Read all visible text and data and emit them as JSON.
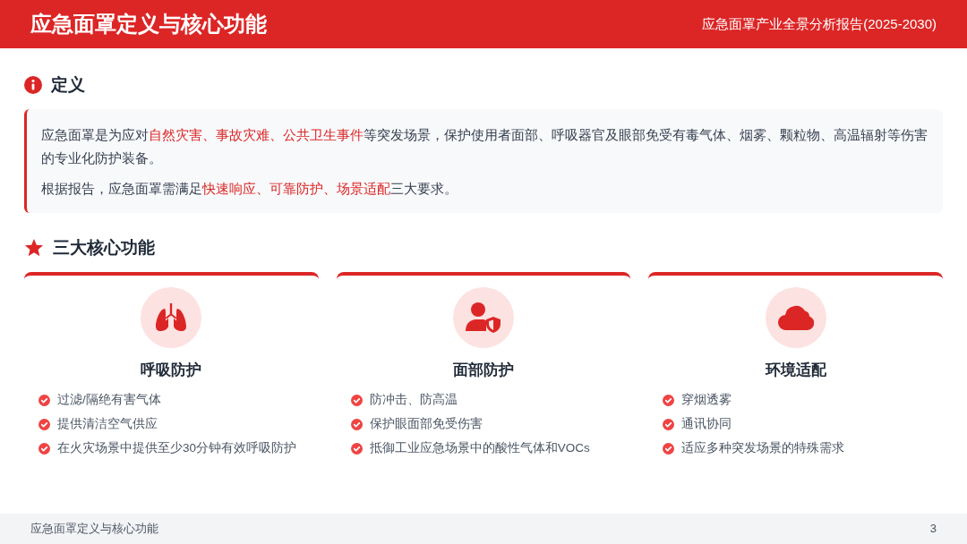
{
  "header": {
    "title": "应急面罩定义与核心功能",
    "report": "应急面罩产业全景分析报告(2025-2030)"
  },
  "definition": {
    "heading": "定义",
    "paragraphs": [
      [
        {
          "text": "应急面罩是为应对",
          "highlight": false
        },
        {
          "text": "自然灾害、事故灾难、公共卫生事件",
          "highlight": true
        },
        {
          "text": "等突发场景，保护使用者面部、呼吸器官及眼部免受有毒气体、烟雾、颗粒物、高温辐射等伤害的专业化防护装备。",
          "highlight": false
        }
      ],
      [
        {
          "text": "根据报告，应急面罩需满足",
          "highlight": false
        },
        {
          "text": "快速响应、可靠防护、场景适配",
          "highlight": true
        },
        {
          "text": "三大要求。",
          "highlight": false
        }
      ]
    ]
  },
  "functions": {
    "heading": "三大核心功能",
    "cards": [
      {
        "kind": "lungs",
        "title": "呼吸防护",
        "items": [
          "过滤/隔绝有害气体",
          "提供清洁空气供应",
          "在火灾场景中提供至少30分钟有效呼吸防护"
        ]
      },
      {
        "kind": "person-shield",
        "title": "面部防护",
        "items": [
          "防冲击、防高温",
          "保护眼面部免受伤害",
          "抵御工业应急场景中的酸性气体和VOCs"
        ]
      },
      {
        "kind": "cloud",
        "title": "环境适配",
        "items": [
          "穿烟透雾",
          "通讯协同",
          "适应多种突发场景的特殊需求"
        ]
      }
    ]
  },
  "footer": {
    "title": "应急面罩定义与核心功能",
    "page": "3"
  }
}
